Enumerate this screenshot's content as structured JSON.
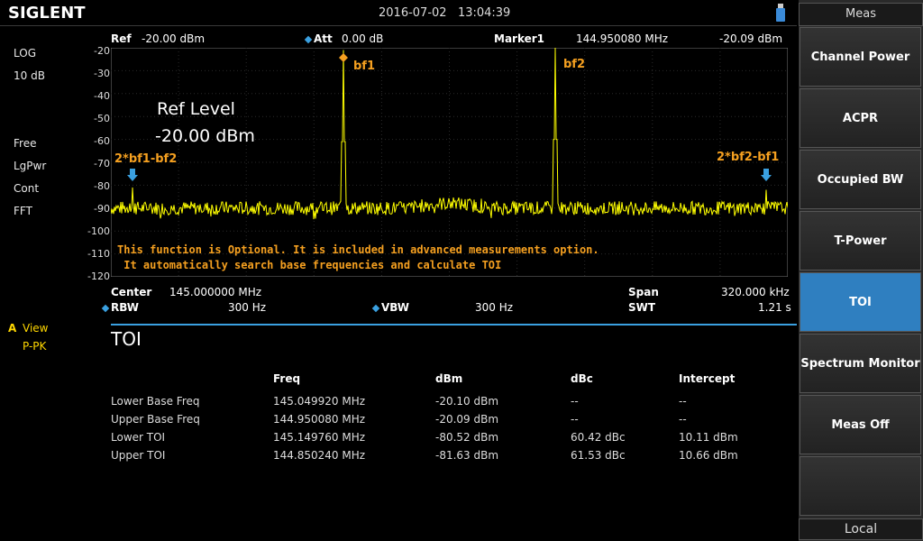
{
  "header": {
    "brand": "SIGLENT",
    "datetime": "2016-07-02   13:04:39"
  },
  "left_panel": {
    "scale_type": "LOG",
    "scale_div": "10 dB",
    "trigger": "Free",
    "detector": "LgPwr",
    "sweep_mode": "Cont",
    "sweep_type": "FFT",
    "trace_view_prefix": "A",
    "trace_view": "View",
    "trace_detector": "P-PK"
  },
  "status": {
    "ref_label": "Ref",
    "ref_value": "-20.00 dBm",
    "att_label": "Att",
    "att_value": "0.00 dB",
    "marker_label": "Marker1",
    "marker_freq": "144.950080 MHz",
    "marker_level": "-20.09 dBm"
  },
  "plot": {
    "y_ticks": [
      "-20",
      "-30",
      "-40",
      "-50",
      "-60",
      "-70",
      "-80",
      "-90",
      "-100",
      "-110",
      "-120"
    ],
    "ref_level_title": "Ref Level",
    "ref_level_value": "-20.00 dBm",
    "marker_labels": {
      "bf1": "bf1",
      "bf2": "bf2",
      "im_low": "2*bf1-bf2",
      "im_high": "2*bf2-bf1"
    },
    "note_line1": "This function is Optional. It is included in advanced measurements option.",
    "note_line2": " It automatically search base frequencies and calculate TOI",
    "trace_color": "#ffff00"
  },
  "footer_params": {
    "center_label": "Center",
    "center_value": "145.000000 MHz",
    "span_label": "Span",
    "span_value": "320.000 kHz",
    "rbw_label": "RBW",
    "rbw_value": "300 Hz",
    "vbw_label": "VBW",
    "vbw_value": "300 Hz",
    "swt_label": "SWT",
    "swt_value": "1.21 s"
  },
  "toi": {
    "title": "TOI",
    "columns": [
      "Freq",
      "dBm",
      "dBc",
      "Intercept"
    ],
    "rows": [
      [
        "Lower Base Freq",
        "145.049920 MHz",
        "-20.10 dBm",
        "--",
        "--"
      ],
      [
        "Upper Base Freq",
        "144.950080 MHz",
        "-20.09 dBm",
        "--",
        "--"
      ],
      [
        "Lower TOI",
        "145.149760 MHz",
        "-80.52 dBm",
        "60.42 dBc",
        "10.11 dBm"
      ],
      [
        "Upper TOI",
        "144.850240 MHz",
        "-81.63 dBm",
        "61.53 dBc",
        "10.66 dBm"
      ]
    ]
  },
  "menu": {
    "title": "Meas",
    "items": [
      "Channel Power",
      "ACPR",
      "Occupied BW",
      "T-Power",
      "TOI",
      "Spectrum Monitor",
      "Meas Off",
      ""
    ],
    "active_index": 4,
    "footer": "Local"
  }
}
